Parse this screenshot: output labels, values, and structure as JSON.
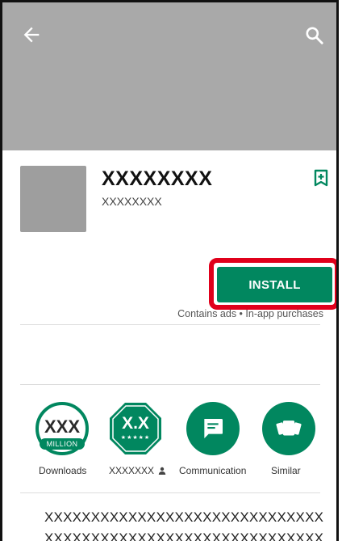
{
  "header": {
    "back_icon": "arrow-back-icon",
    "search_icon": "search-icon"
  },
  "app": {
    "name": "XXXXXXXX",
    "developer": "XXXXXXXX",
    "wishlist_icon": "bookmark-add-icon"
  },
  "install": {
    "label": "INSTALL",
    "note": "Contains ads • In-app purchases",
    "accent": "#01875f",
    "highlight_color": "#e0001b"
  },
  "badges": {
    "downloads": {
      "value": "XXX",
      "unit": "MILLION",
      "label": "Downloads"
    },
    "rating": {
      "value": "X.X",
      "stars": "★★★★★",
      "label": "XXXXXXX",
      "icon": "person-icon"
    },
    "category": {
      "label": "Communication",
      "icon": "chat-bubble-icon"
    },
    "similar": {
      "label": "Similar",
      "icon": "cards-icon"
    }
  },
  "description": {
    "lines": [
      "XXXXXXXXXXXXXXXXXXXXXXXXXXXXXX",
      "XXXXXXXXXXXXXXXXXXXXXXXXXXXXXX"
    ]
  }
}
